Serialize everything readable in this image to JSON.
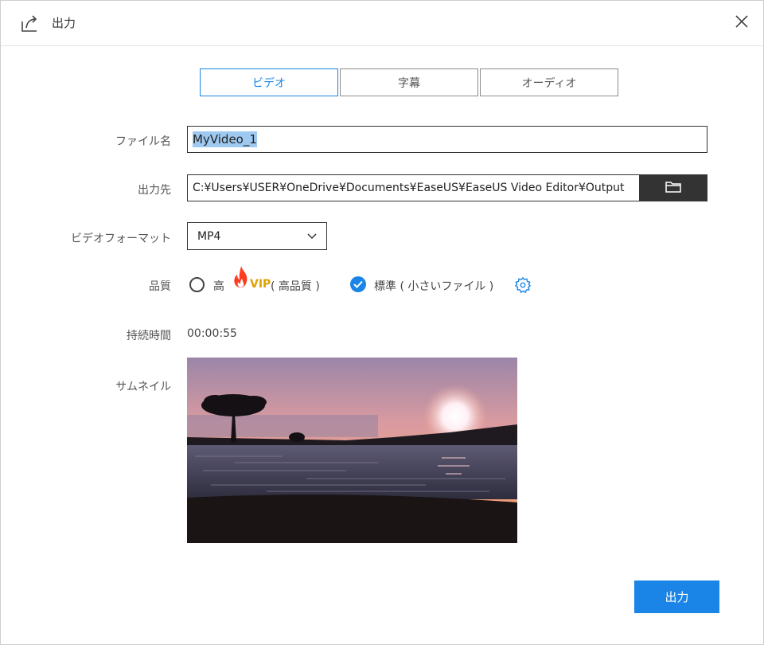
{
  "window": {
    "title": "出力"
  },
  "tabs": [
    {
      "label": "ビデオ",
      "active": true
    },
    {
      "label": "字幕",
      "active": false
    },
    {
      "label": "オーディオ",
      "active": false
    }
  ],
  "form": {
    "filename_label": "ファイル名",
    "filename_value": "MyVideo_1",
    "output_label": "出力先",
    "output_path": "C:¥Users¥USER¥OneDrive¥Documents¥EaseUS¥EaseUS Video Editor¥Output",
    "format_label": "ビデオフォーマット",
    "format_value": "MP4",
    "quality_label": "品質",
    "quality_high": "高",
    "quality_high_badge": "VIP",
    "quality_high_desc": "( 高品質 )",
    "quality_standard": "標準 ( 小さいファイル )",
    "quality_selected": "standard",
    "duration_label": "持続時間",
    "duration_value": "00:00:55",
    "thumbnail_label": "サムネイル"
  },
  "footer": {
    "export_label": "出力"
  },
  "colors": {
    "accent": "#1a85e6",
    "vip": "#e0a100",
    "dark_button": "#333333"
  },
  "icons": {
    "title": "export-icon",
    "close": "close-icon",
    "browse": "folder-icon",
    "dropdown": "chevron-down-icon",
    "fire": "fire-icon",
    "settings": "gear-icon"
  }
}
